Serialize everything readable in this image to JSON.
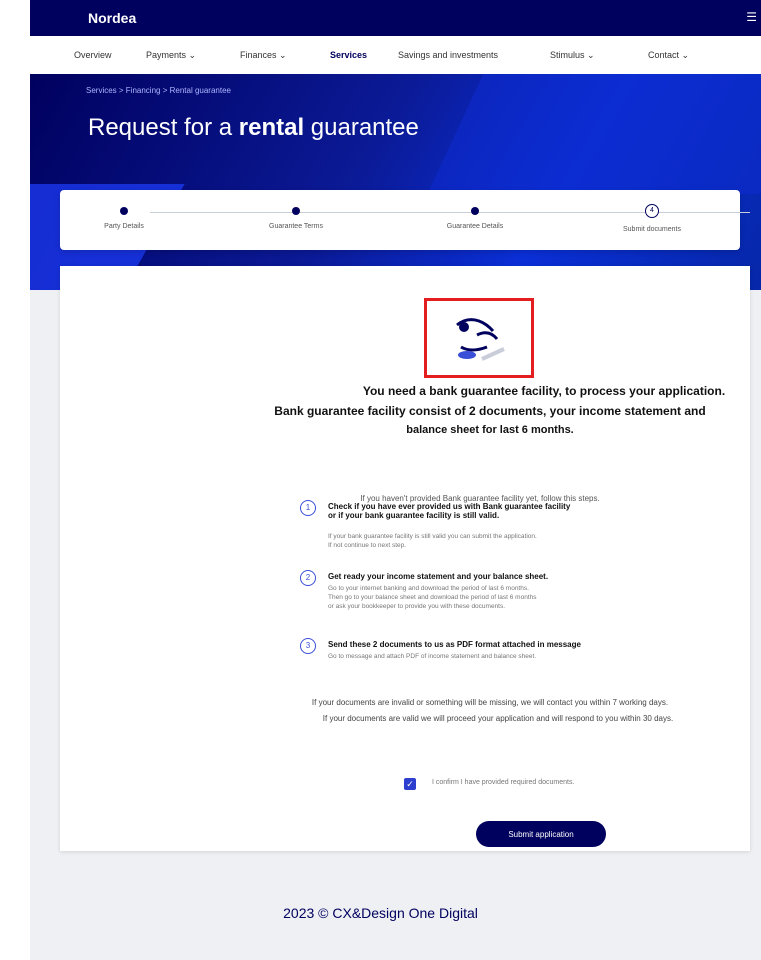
{
  "brand": "Nordea",
  "nav": {
    "items": [
      "Overview",
      "Payments",
      "Finances",
      "Services",
      "Savings and investments",
      "Stimulus",
      "Contact"
    ],
    "active": "Services"
  },
  "hero": {
    "breadcrumb": "Services  >  Financing  >  Rental guarantee",
    "title_light": "Request for a ",
    "title_bold": "rental",
    "title_tail": " guarantee"
  },
  "steps": [
    {
      "label": "Party Details",
      "status": "done"
    },
    {
      "label": "Guarantee Terms",
      "status": "done"
    },
    {
      "label": "Guarantee Details",
      "status": "done"
    },
    {
      "label": "Submit documents",
      "status": "current",
      "number": "4"
    }
  ],
  "illustration_icon": "handshake-illustration-icon",
  "main": {
    "heading1": "You need a bank guarantee facility, to process your application.",
    "heading2": "Bank guarantee facility consist of 2 documents, your income statement and",
    "heading3": "balance sheet for last 6 months.",
    "intro": "If you haven't provided Bank guarantee facility yet, follow this steps.",
    "instructions": [
      {
        "num": "1",
        "title": "Check if you have ever provided us with Bank guarantee facility",
        "title2": "or if your bank guarantee facility is still valid.",
        "body1": "If your bank guarantee facility is still valid you can submit the application.",
        "body2": "If not continue to next step."
      },
      {
        "num": "2",
        "title": "Get ready your income statement and your balance sheet.",
        "body1": "Go to your internet banking and download the period of last 6 months.",
        "body2": "Then go to your balance sheet and download the period of last 6 months",
        "body3": "or ask your bookkeeper to provide you with these documents."
      },
      {
        "num": "3",
        "title": "Send these 2 documents to us as PDF format attached in message",
        "body1": "Go to message and attach PDF of income statement and balance sheet."
      }
    ],
    "footnote1": "If your documents are invalid or something will be missing, we will contact you within 7 working days.",
    "footnote2": "If your documents are valid we will proceed your application and will respond to you within 30 days.",
    "confirm_label": "I confirm I have provided required documents.",
    "submit_label": "Submit application"
  },
  "footer": "2023 © CX&Design One Digital",
  "colors": {
    "brand": "#00005e",
    "accent": "#2d3fcf",
    "highlight": "#e41e1e"
  }
}
